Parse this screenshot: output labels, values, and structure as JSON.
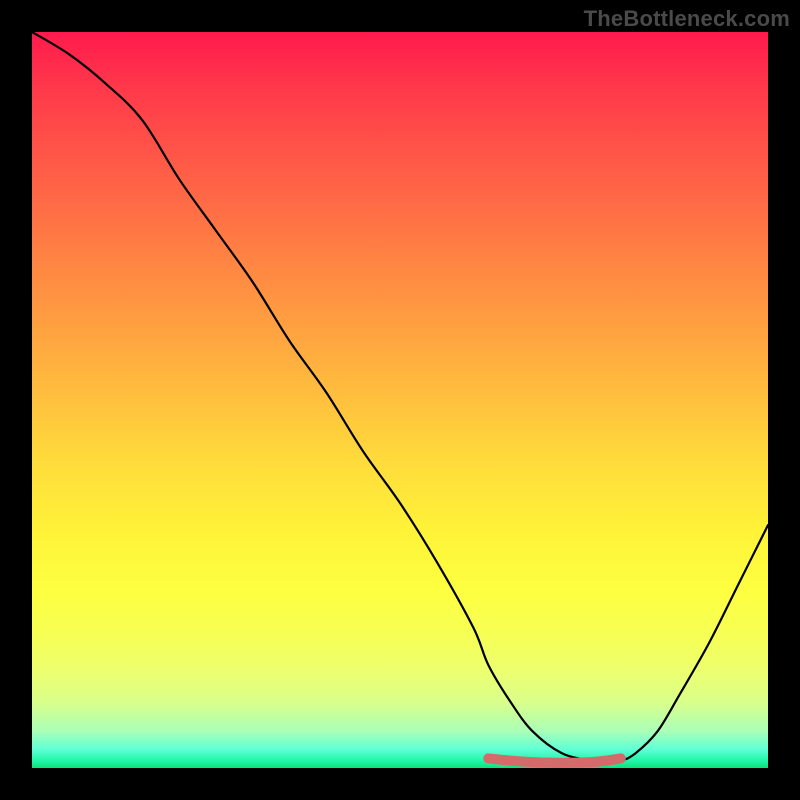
{
  "watermark": "TheBottleneck.com",
  "chart_data": {
    "type": "line",
    "title": "",
    "xlabel": "",
    "ylabel": "",
    "xlim": [
      0,
      100
    ],
    "ylim": [
      0,
      100
    ],
    "series": [
      {
        "name": "bottleneck-curve",
        "x": [
          0,
          5,
          10,
          15,
          20,
          25,
          30,
          35,
          40,
          45,
          50,
          55,
          60,
          62,
          65,
          68,
          72,
          76,
          78,
          80,
          82,
          85,
          88,
          92,
          96,
          100
        ],
        "values": [
          100,
          97,
          93,
          88,
          80,
          73,
          66,
          58,
          51,
          43,
          36,
          28,
          19,
          14,
          9,
          5,
          2,
          1,
          1,
          1,
          2,
          5,
          10,
          17,
          25,
          33
        ]
      },
      {
        "name": "optimal-band",
        "x": [
          62,
          65,
          68,
          72,
          76,
          78,
          80
        ],
        "values": [
          1.3,
          1.0,
          0.8,
          0.7,
          0.8,
          1.0,
          1.3
        ]
      }
    ],
    "annotations": [],
    "legend": false,
    "grid": false
  },
  "colors": {
    "curve": "#000000",
    "optimal_band": "#d46a6a"
  }
}
